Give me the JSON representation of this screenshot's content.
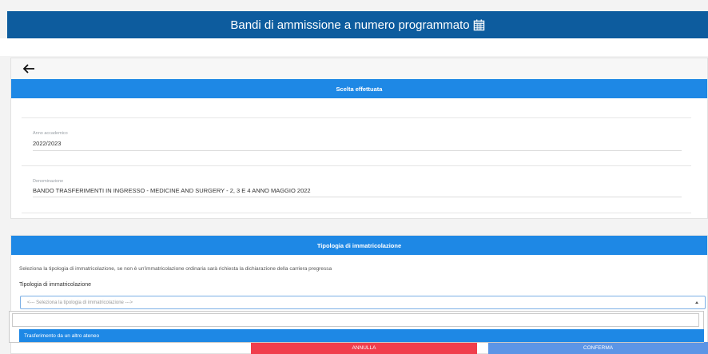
{
  "header": {
    "title": "Bandi di ammissione a numero programmato",
    "icon": "calendar-icon"
  },
  "choice": {
    "section_title": "Scelta effettuata",
    "year_label": "Anno accademico",
    "year_value": "2022/2023",
    "name_label": "Denominazione",
    "name_value": "BANDO TRASFERIMENTI IN INGRESSO - MEDICINE AND SURGERY - 2, 3 E 4 ANNO MAGGIO 2022"
  },
  "enrollment": {
    "section_title": "Tipologia di immatricolazione",
    "description": "Seleziona la tipologia di immatricolazione, se non è un'immatricolazione ordinaria sarà richiesta la dichiarazione della carriera pregressa",
    "field_label": "Tipologia di immatricolazione",
    "select_placeholder": "<--- Seleziona la tipologia di immatricolazione --->",
    "search_value": "",
    "options": [
      "Trasferimento da un altro ateneo"
    ]
  },
  "actions": {
    "cancel_label": "ANNULLA",
    "confirm_label": "CONFERMA"
  },
  "colors": {
    "header": "#0d5c9e",
    "section": "#1e88e5",
    "cancel": "#f03e4c",
    "confirm": "#5c95e6"
  }
}
